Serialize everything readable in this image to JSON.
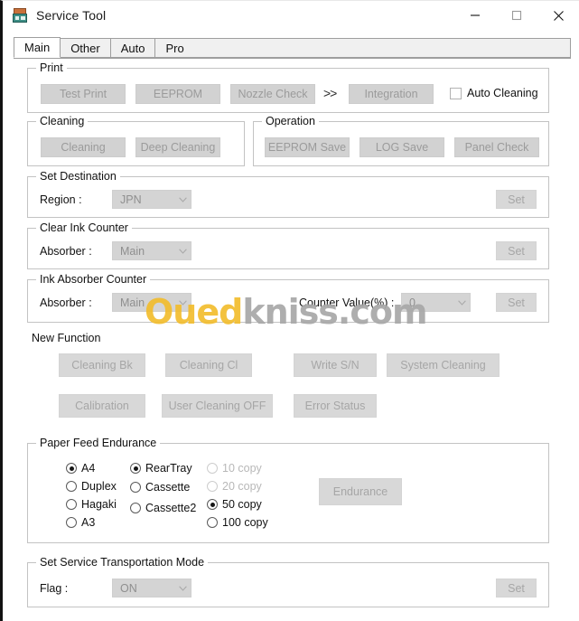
{
  "window": {
    "title": "Service Tool",
    "icon": "printer-icon",
    "minimize": "minimize-icon",
    "maximize": "maximize-icon",
    "close": "close-icon"
  },
  "tabs": [
    {
      "label": "Main",
      "active": true
    },
    {
      "label": "Other",
      "active": false
    },
    {
      "label": "Auto",
      "active": false
    },
    {
      "label": "Pro",
      "active": false
    }
  ],
  "print": {
    "legend": "Print",
    "test_print": "Test Print",
    "eeprom": "EEPROM",
    "nozzle_check": "Nozzle Check",
    "chevrons": ">>",
    "integration": "Integration",
    "auto_cleaning": "Auto Cleaning",
    "auto_cleaning_checked": false
  },
  "cleaning": {
    "legend": "Cleaning",
    "cleaning": "Cleaning",
    "deep_cleaning": "Deep Cleaning"
  },
  "operation": {
    "legend": "Operation",
    "eeprom_save": "EEPROM Save",
    "log_save": "LOG Save",
    "panel_check": "Panel Check"
  },
  "set_destination": {
    "legend": "Set Destination",
    "region_label": "Region :",
    "region_value": "JPN",
    "set": "Set"
  },
  "clear_ink_counter": {
    "legend": "Clear Ink Counter",
    "absorber_label": "Absorber :",
    "absorber_value": "Main",
    "set": "Set"
  },
  "ink_absorber_counter": {
    "legend": "Ink Absorber Counter",
    "absorber_label": "Absorber :",
    "absorber_value": "Main",
    "counter_label": "Counter Value(%) :",
    "counter_value": "0",
    "set": "Set"
  },
  "new_function": {
    "legend": "New Function",
    "cleaning_bk": "Cleaning Bk",
    "cleaning_cl": "Cleaning Cl",
    "write_sn": "Write S/N",
    "system_cleaning": "System Cleaning",
    "calibration": "Calibration",
    "user_cleaning_off": "User Cleaning OFF",
    "error_status": "Error Status"
  },
  "paper_feed_endurance": {
    "legend": "Paper Feed Endurance",
    "paper_sizes": [
      {
        "label": "A4",
        "selected": true,
        "disabled": false
      },
      {
        "label": "Duplex",
        "selected": false,
        "disabled": false
      },
      {
        "label": "Hagaki",
        "selected": false,
        "disabled": false
      },
      {
        "label": "A3",
        "selected": false,
        "disabled": false
      }
    ],
    "sources": [
      {
        "label": "RearTray",
        "selected": true,
        "disabled": false
      },
      {
        "label": "Cassette",
        "selected": false,
        "disabled": false
      },
      {
        "label": "Cassette2",
        "selected": false,
        "disabled": false
      }
    ],
    "copies": [
      {
        "label": "10 copy",
        "selected": false,
        "disabled": true
      },
      {
        "label": "20 copy",
        "selected": false,
        "disabled": true
      },
      {
        "label": "50 copy",
        "selected": true,
        "disabled": false
      },
      {
        "label": "100 copy",
        "selected": false,
        "disabled": false
      }
    ],
    "endurance": "Endurance"
  },
  "set_service_transportation_mode": {
    "legend": "Set Service Transportation Mode",
    "flag_label": "Flag :",
    "flag_value": "ON",
    "set": "Set"
  },
  "watermark": {
    "part_a": "Oued",
    "part_b": "kniss.com",
    "color_a": "#f2bd2e",
    "color_b": "#a8a8a8"
  }
}
